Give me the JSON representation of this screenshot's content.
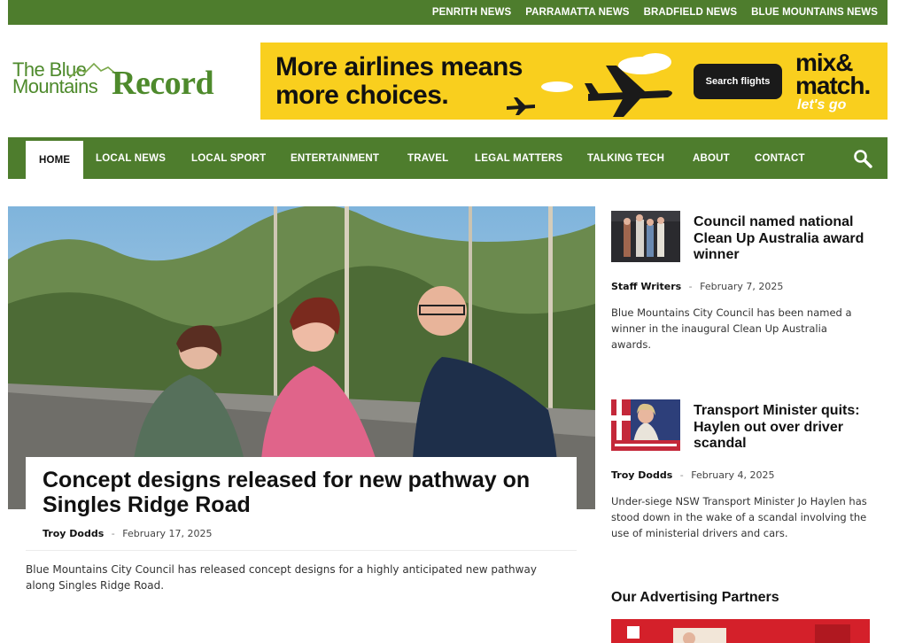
{
  "topbar": {
    "links": [
      "PENRITH NEWS",
      "PARRAMATTA NEWS",
      "BRADFIELD NEWS",
      "BLUE MOUNTAINS NEWS"
    ]
  },
  "logo": {
    "line1": "The Blue",
    "line2": "Mountains",
    "line3": "Record"
  },
  "ad": {
    "headline_line1": "More airlines means",
    "headline_line2": "more choices.",
    "cta": "Search flights",
    "brand_line1": "mix&",
    "brand_line2": "match.",
    "brand_tag": "let's go"
  },
  "nav": {
    "items": [
      "HOME",
      "LOCAL NEWS",
      "LOCAL SPORT",
      "ENTERTAINMENT",
      "TRAVEL",
      "LEGAL MATTERS",
      "TALKING TECH",
      "ABOUT",
      "CONTACT"
    ],
    "active": "HOME"
  },
  "featured": {
    "title": "Concept designs released for new pathway on Singles Ridge Road",
    "author": "Troy Dodds",
    "separator": "-",
    "date": "February 17, 2025",
    "excerpt": "Blue Mountains City Council has released concept designs for a highly anticipated new pathway along Singles Ridge Road."
  },
  "sidebar": {
    "stories": [
      {
        "title": "Council named national Clean Up Australia award winner",
        "author": "Staff Writers",
        "separator": "-",
        "date": "February 7, 2025",
        "excerpt": "Blue Mountains City Council has been named a winner in the inaugural Clean Up Australia awards."
      },
      {
        "title": "Transport Minister quits: Haylen out over driver scandal",
        "author": "Troy Dodds",
        "separator": "-",
        "date": "February 4, 2025",
        "excerpt": "Under-siege NSW Transport Minister Jo Haylen has stood down in the wake of a scandal involving the use of ministerial drivers and cars."
      }
    ],
    "partners_heading": "Our Advertising Partners"
  },
  "colors": {
    "brand_green": "#4e7d2d",
    "logo_green": "#4e8a2c",
    "ad_yellow": "#f9cf1e"
  },
  "icons": {
    "search": "search-icon",
    "logo_mountains": "mountain-icon",
    "ad_plane": "plane-icon"
  }
}
